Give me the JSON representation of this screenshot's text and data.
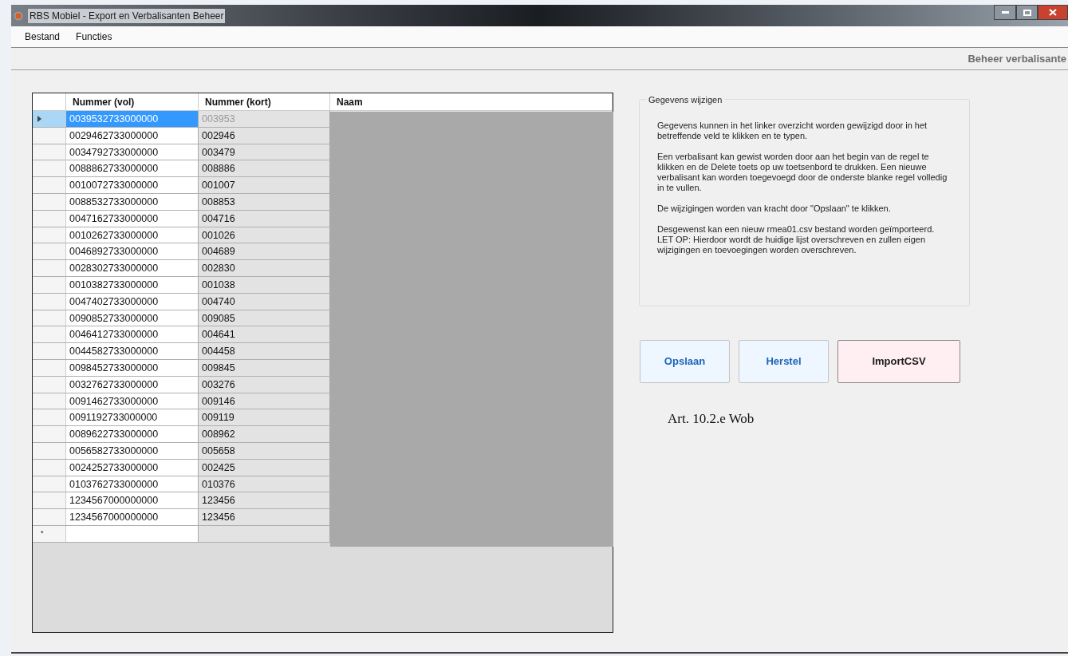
{
  "window": {
    "title": "RBS Mobiel - Export en Verbalisanten Beheer"
  },
  "menu": [
    "Bestand",
    "Functies"
  ],
  "toolbar": {
    "label": "Beheer verbalisante"
  },
  "grid": {
    "columns": [
      "Nummer (vol)",
      "Nummer (kort)",
      "Naam"
    ],
    "new_row_marker": "*",
    "rows": [
      {
        "vol": "0039532733000000",
        "kort": "003953",
        "selected": true
      },
      {
        "vol": "0029462733000000",
        "kort": "002946",
        "selected": false
      },
      {
        "vol": "0034792733000000",
        "kort": "003479",
        "selected": false
      },
      {
        "vol": "0088862733000000",
        "kort": "008886",
        "selected": false
      },
      {
        "vol": "0010072733000000",
        "kort": "001007",
        "selected": false
      },
      {
        "vol": "0088532733000000",
        "kort": "008853",
        "selected": false
      },
      {
        "vol": "0047162733000000",
        "kort": "004716",
        "selected": false
      },
      {
        "vol": "0010262733000000",
        "kort": "001026",
        "selected": false
      },
      {
        "vol": "0046892733000000",
        "kort": "004689",
        "selected": false
      },
      {
        "vol": "0028302733000000",
        "kort": "002830",
        "selected": false
      },
      {
        "vol": "0010382733000000",
        "kort": "001038",
        "selected": false
      },
      {
        "vol": "0047402733000000",
        "kort": "004740",
        "selected": false
      },
      {
        "vol": "0090852733000000",
        "kort": "009085",
        "selected": false
      },
      {
        "vol": "0046412733000000",
        "kort": "004641",
        "selected": false
      },
      {
        "vol": "0044582733000000",
        "kort": "004458",
        "selected": false
      },
      {
        "vol": "0098452733000000",
        "kort": "009845",
        "selected": false
      },
      {
        "vol": "0032762733000000",
        "kort": "003276",
        "selected": false
      },
      {
        "vol": "0091462733000000",
        "kort": "009146",
        "selected": false
      },
      {
        "vol": "0091192733000000",
        "kort": "009119",
        "selected": false
      },
      {
        "vol": "0089622733000000",
        "kort": "008962",
        "selected": false
      },
      {
        "vol": "0056582733000000",
        "kort": "005658",
        "selected": false
      },
      {
        "vol": "0024252733000000",
        "kort": "002425",
        "selected": false
      },
      {
        "vol": "0103762733000000",
        "kort": "010376",
        "selected": false
      },
      {
        "vol": "1234567000000000",
        "kort": "123456",
        "selected": false
      },
      {
        "vol": "1234567000000000",
        "kort": "123456",
        "selected": false
      }
    ]
  },
  "info": {
    "title": "Gegevens wijzigen",
    "paragraphs": [
      "Gegevens kunnen in het linker overzicht worden gewijzigd door in het betreffende veld te klikken en te typen.",
      "Een verbalisant kan gewist worden door aan het begin van de regel te klikken en de Delete toets op uw toetsenbord te drukken. Een nieuwe verbalisant kan worden toegevoegd door de onderste blanke regel volledig in te vullen.",
      "De wijzigingen worden van kracht door \"Opslaan\" te klikken.",
      "Desgewenst kan een nieuw rmea01.csv bestand worden geïmporteerd. LET OP: Hierdoor wordt de huidige lijst overschreven en zullen eigen wijzigingen en toevoegingen worden overschreven."
    ]
  },
  "buttons": [
    {
      "label": "Opslaan",
      "kind": "normal"
    },
    {
      "label": "Herstel",
      "kind": "normal"
    },
    {
      "label": "ImportCSV",
      "kind": "accent"
    }
  ],
  "note": "Art. 10.2.e Wob"
}
